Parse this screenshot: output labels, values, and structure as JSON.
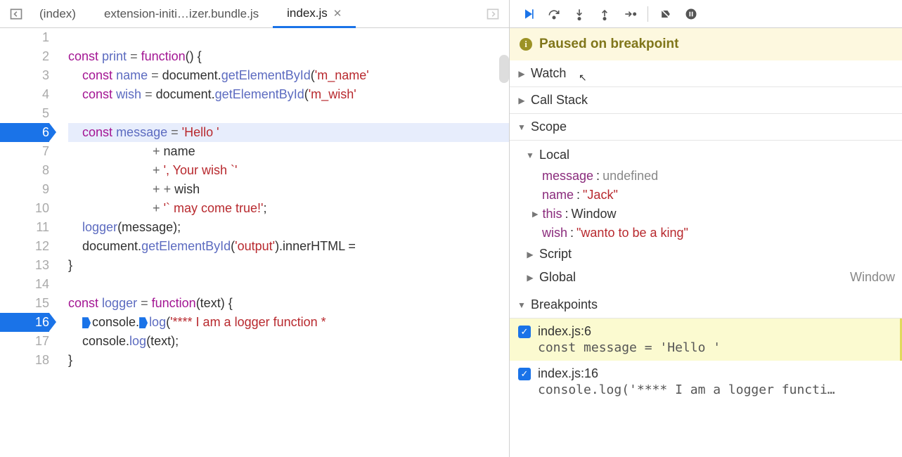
{
  "tabs": {
    "back_enabled": true,
    "forward_enabled": false,
    "items": [
      {
        "label": "(index)",
        "active": false,
        "closable": false
      },
      {
        "label": "extension-initi…izer.bundle.js",
        "active": false,
        "closable": false
      },
      {
        "label": "index.js",
        "active": true,
        "closable": true
      }
    ]
  },
  "code": {
    "lines": [
      {
        "n": 1,
        "tokens": []
      },
      {
        "n": 2,
        "tokens": [
          [
            "kw",
            "const"
          ],
          [
            "",
            " "
          ],
          [
            "fn",
            "print"
          ],
          [
            "",
            " "
          ],
          [
            "op",
            "="
          ],
          [
            "",
            " "
          ],
          [
            "kw",
            "function"
          ],
          [
            "",
            "() {"
          ]
        ]
      },
      {
        "n": 3,
        "tokens": [
          [
            "",
            "    "
          ],
          [
            "kw",
            "const"
          ],
          [
            "",
            " "
          ],
          [
            "fn",
            "name"
          ],
          [
            "",
            " "
          ],
          [
            "op",
            "="
          ],
          [
            "",
            " document."
          ],
          [
            "fn",
            "getElementById"
          ],
          [
            "",
            "("
          ],
          [
            "str",
            "'m_name'"
          ]
        ]
      },
      {
        "n": 4,
        "tokens": [
          [
            "",
            "    "
          ],
          [
            "kw",
            "const"
          ],
          [
            "",
            " "
          ],
          [
            "fn",
            "wish"
          ],
          [
            "",
            " "
          ],
          [
            "op",
            "="
          ],
          [
            "",
            " document."
          ],
          [
            "fn",
            "getElementById"
          ],
          [
            "",
            "("
          ],
          [
            "str",
            "'m_wish'"
          ]
        ]
      },
      {
        "n": 5,
        "tokens": []
      },
      {
        "n": 6,
        "exec": true,
        "tokens": [
          [
            "",
            "    "
          ],
          [
            "kw",
            "const"
          ],
          [
            "",
            " "
          ],
          [
            "fn",
            "message"
          ],
          [
            "",
            " "
          ],
          [
            "op",
            "="
          ],
          [
            "",
            " "
          ],
          [
            "str",
            "'Hello '"
          ]
        ]
      },
      {
        "n": 7,
        "tokens": [
          [
            "",
            "                        "
          ],
          [
            "op",
            "+"
          ],
          [
            "",
            " name"
          ]
        ]
      },
      {
        "n": 8,
        "tokens": [
          [
            "",
            "                        "
          ],
          [
            "op",
            "+"
          ],
          [
            "",
            " "
          ],
          [
            "str",
            "', Your wish `'"
          ]
        ]
      },
      {
        "n": 9,
        "tokens": [
          [
            "",
            "                        "
          ],
          [
            "op",
            "+"
          ],
          [
            "",
            " "
          ],
          [
            "op",
            "+"
          ],
          [
            "",
            " wish"
          ]
        ]
      },
      {
        "n": 10,
        "tokens": [
          [
            "",
            "                        "
          ],
          [
            "op",
            "+"
          ],
          [
            "",
            " "
          ],
          [
            "str",
            "'` may come true!'"
          ],
          [
            "",
            ";"
          ]
        ]
      },
      {
        "n": 11,
        "tokens": [
          [
            "",
            "    "
          ],
          [
            "fn",
            "logger"
          ],
          [
            "",
            "(message);"
          ]
        ]
      },
      {
        "n": 12,
        "tokens": [
          [
            "",
            "    document."
          ],
          [
            "fn",
            "getElementById"
          ],
          [
            "",
            "("
          ],
          [
            "str",
            "'output'"
          ],
          [
            "",
            ").innerHTML ="
          ]
        ]
      },
      {
        "n": 13,
        "tokens": [
          [
            "",
            "}"
          ]
        ]
      },
      {
        "n": 14,
        "tokens": []
      },
      {
        "n": 15,
        "tokens": [
          [
            "kw",
            "const"
          ],
          [
            "",
            " "
          ],
          [
            "fn",
            "logger"
          ],
          [
            "",
            " "
          ],
          [
            "op",
            "="
          ],
          [
            "",
            " "
          ],
          [
            "kw",
            "function"
          ],
          [
            "",
            "(text) {"
          ]
        ]
      },
      {
        "n": 16,
        "bp": true,
        "marker": true,
        "tokens": [
          [
            "",
            "    "
          ],
          [
            "",
            "MARKER"
          ],
          [
            "",
            "console."
          ],
          [
            "",
            "MARKER"
          ],
          [
            "fn",
            "log"
          ],
          [
            "",
            "("
          ],
          [
            "str",
            "'**** I am a logger function *"
          ]
        ]
      },
      {
        "n": 17,
        "tokens": [
          [
            "",
            "    console."
          ],
          [
            "fn",
            "log"
          ],
          [
            "",
            "(text);"
          ]
        ]
      },
      {
        "n": 18,
        "tokens": [
          [
            "",
            "}"
          ]
        ]
      }
    ]
  },
  "debug": {
    "status": "Paused on breakpoint",
    "sections": {
      "watch": {
        "label": "Watch",
        "expanded": false
      },
      "callstack": {
        "label": "Call Stack",
        "expanded": false
      },
      "scope": {
        "label": "Scope",
        "expanded": true,
        "local": {
          "label": "Local",
          "vars": [
            {
              "name": "message",
              "value": "undefined",
              "type": "undef"
            },
            {
              "name": "name",
              "value": "\"Jack\"",
              "type": "str"
            },
            {
              "name": "this",
              "value": "Window",
              "type": "obj",
              "expandable": true
            },
            {
              "name": "wish",
              "value": "\"wanto to be a king\"",
              "type": "str"
            }
          ]
        },
        "script": {
          "label": "Script"
        },
        "global": {
          "label": "Global",
          "hint": "Window"
        }
      },
      "breakpoints": {
        "label": "Breakpoints",
        "items": [
          {
            "loc": "index.js:6",
            "src": "const message = 'Hello '",
            "checked": true,
            "active": true
          },
          {
            "loc": "index.js:16",
            "src": "console.log('**** I am a logger functi…",
            "checked": true,
            "active": false
          }
        ]
      }
    }
  }
}
